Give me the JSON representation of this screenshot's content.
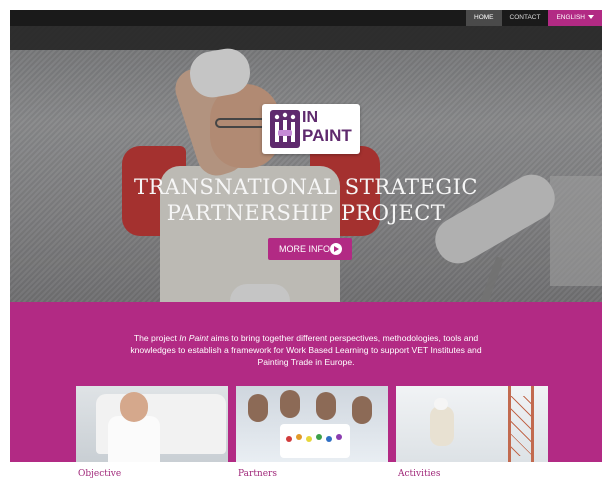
{
  "nav": {
    "items": [
      {
        "label": "HOME",
        "active": true
      },
      {
        "label": "CONTACT",
        "active": false
      }
    ],
    "language": "ENGLISH"
  },
  "hero": {
    "logo_line1": "IN",
    "logo_line2": "PAINT",
    "title_line1": "TRANSNATIONAL STRATEGIC",
    "title_line2": "PARTNERSHIP PROJECT",
    "button_label": "MORE INFO"
  },
  "intro": {
    "prefix": "The project ",
    "project_name": "In Paint",
    "suffix": " aims to bring together different perspectives, methodologies, tools and knowledges to establish a framework for Work Based Learning to support VET Institutes and Painting Trade in Europe."
  },
  "cards": [
    {
      "title": "Objective"
    },
    {
      "title": "Partners"
    },
    {
      "title": "Activities"
    }
  ],
  "colors": {
    "brand_magenta": "#b22a84",
    "brand_purple": "#5f2a6e",
    "nav_bg": "#1a1a1a"
  }
}
